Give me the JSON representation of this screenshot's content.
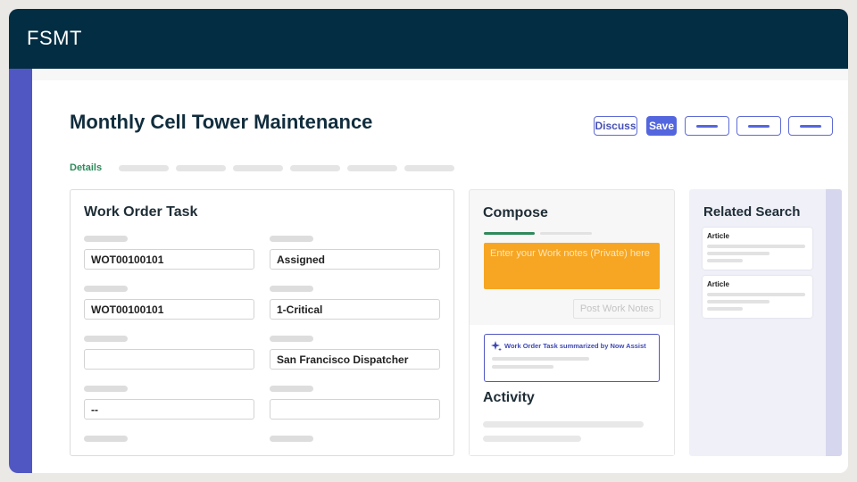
{
  "app": {
    "name": "FSMT"
  },
  "page": {
    "title": "Monthly Cell Tower Maintenance"
  },
  "toolbar": {
    "discuss_label": "Discuss",
    "save_label": "Save"
  },
  "tabs": {
    "active": "Details"
  },
  "work_order": {
    "title": "Work Order Task",
    "fields": {
      "number": "WOT00100101",
      "state": "Assigned",
      "parent": "WOT00100101",
      "priority": "1-Critical",
      "field5": "",
      "assignment_group": "San Francisco Dispatcher",
      "field7": "--",
      "field8": ""
    }
  },
  "compose": {
    "title": "Compose",
    "placeholder": "Enter your Work notes (Private) here",
    "post_label": "Post Work Notes",
    "assist_text": "Work Order Task summarized by Now Assist",
    "activity_title": "Activity"
  },
  "related": {
    "title": "Related Search",
    "articles": [
      {
        "label": "Article"
      },
      {
        "label": "Article"
      }
    ]
  },
  "colors": {
    "header_bg": "#032d42",
    "accent_rail": "#5157c2",
    "primary_button": "#5466de",
    "active_tab": "#2e8a5b",
    "worknotes_bg": "#f6a623"
  },
  "icons": {
    "assist": "sparkle-icon"
  }
}
